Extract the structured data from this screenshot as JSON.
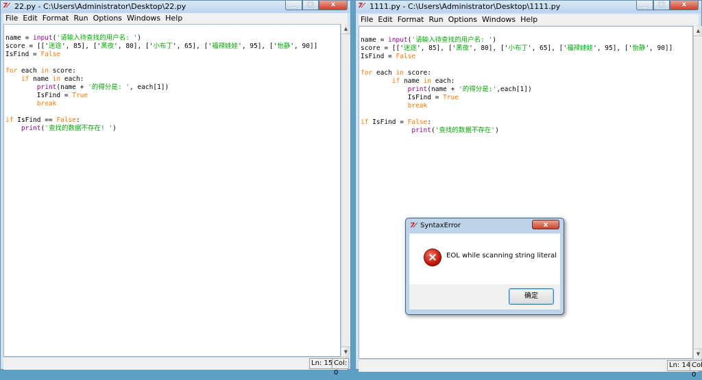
{
  "left_window": {
    "title": "22.py - C:\\Users\\Administrator\\Desktop\\22.py",
    "icon": "tk-feather-icon",
    "menu": [
      "File",
      "Edit",
      "Format",
      "Run",
      "Options",
      "Windows",
      "Help"
    ],
    "status_ln": "Ln: 15",
    "status_col": "Col: 0"
  },
  "right_window": {
    "title": "1111.py - C:\\Users\\Administrator\\Desktop\\1111.py",
    "icon": "tk-feather-icon",
    "menu": [
      "File",
      "Edit",
      "Format",
      "Run",
      "Options",
      "Windows",
      "Help"
    ],
    "status_ln": "Ln: 14",
    "status_col": "Col: 0"
  },
  "left_code": [
    [
      [
        "",
        "name = "
      ],
      [
        "bi",
        "input"
      ],
      [
        "",
        "("
      ],
      [
        "st",
        "'请输入待查找的用户名: '"
      ],
      [
        "",
        ")"
      ]
    ],
    [
      [
        "",
        "score = [['"
      ],
      [
        "st",
        "迷途"
      ],
      [
        "",
        "', 85], ['"
      ],
      [
        "st",
        "黑夜"
      ],
      [
        "",
        "', 80], ['"
      ],
      [
        "st",
        "小布丁"
      ],
      [
        "",
        "', 65], ['"
      ],
      [
        "st",
        "福禄娃娃"
      ],
      [
        "",
        "', 95], ['"
      ],
      [
        "st",
        "怡静"
      ],
      [
        "",
        "', 90]]"
      ]
    ],
    [
      [
        "",
        "IsFind = "
      ],
      [
        "kw",
        "False"
      ]
    ],
    [
      [
        "",
        ""
      ]
    ],
    [
      [
        "kw",
        "for"
      ],
      [
        "",
        " each "
      ],
      [
        "kw",
        "in"
      ],
      [
        "",
        " score:"
      ]
    ],
    [
      [
        "",
        "    "
      ],
      [
        "kw",
        "if"
      ],
      [
        "",
        " name "
      ],
      [
        "kw",
        "in"
      ],
      [
        "",
        " each:"
      ]
    ],
    [
      [
        "",
        "        "
      ],
      [
        "bi",
        "print"
      ],
      [
        "",
        "(name + "
      ],
      [
        "st",
        "'的得分是: '"
      ],
      [
        "",
        ", each[1])"
      ]
    ],
    [
      [
        "",
        "        IsFind = "
      ],
      [
        "kw",
        "True"
      ]
    ],
    [
      [
        "",
        "        "
      ],
      [
        "kw",
        "break"
      ]
    ],
    [
      [
        "",
        ""
      ]
    ],
    [
      [
        "kw",
        "if"
      ],
      [
        "",
        " IsFind == "
      ],
      [
        "kw",
        "False"
      ],
      [
        "",
        ":"
      ]
    ],
    [
      [
        "",
        "    "
      ],
      [
        "bi",
        "print"
      ],
      [
        "",
        "("
      ],
      [
        "st",
        "'查找的数据不存在! '"
      ],
      [
        "",
        ")"
      ]
    ]
  ],
  "right_code": [
    [
      [
        "",
        "name = "
      ],
      [
        "bi",
        "input"
      ],
      [
        "",
        "("
      ],
      [
        "st",
        "'请输入待查找的用户名: '"
      ],
      [
        "",
        ")"
      ]
    ],
    [
      [
        "",
        "score = [['"
      ],
      [
        "st",
        "迷途"
      ],
      [
        "",
        "', 85], ['"
      ],
      [
        "st",
        "黑夜"
      ],
      [
        "",
        "', 80], ['"
      ],
      [
        "st",
        "小布丁"
      ],
      [
        "",
        "', 65], ['"
      ],
      [
        "st",
        "福禄娃娃"
      ],
      [
        "",
        "', 95], ['"
      ],
      [
        "st",
        "怡静"
      ],
      [
        "",
        "', 90]]"
      ]
    ],
    [
      [
        "",
        "IsFind = "
      ],
      [
        "kw",
        "False"
      ]
    ],
    [
      [
        "",
        ""
      ]
    ],
    [
      [
        "kw",
        "for"
      ],
      [
        "",
        " each "
      ],
      [
        "kw",
        "in"
      ],
      [
        "",
        " score:"
      ]
    ],
    [
      [
        "",
        "        "
      ],
      [
        "kw",
        "if"
      ],
      [
        "",
        " name "
      ],
      [
        "kw",
        "in"
      ],
      [
        "",
        " each:"
      ]
    ],
    [
      [
        "",
        "            "
      ],
      [
        "bi",
        "print"
      ],
      [
        "",
        "(name + "
      ],
      [
        "st",
        "'的得分是:'"
      ],
      [
        "",
        ",each[1])"
      ]
    ],
    [
      [
        "",
        "            IsFind = "
      ],
      [
        "kw",
        "True"
      ]
    ],
    [
      [
        "",
        "            "
      ],
      [
        "kw",
        "break"
      ]
    ],
    [
      [
        "",
        ""
      ]
    ],
    [
      [
        "kw",
        "if"
      ],
      [
        "",
        " IsFind = "
      ],
      [
        "kw",
        "False"
      ],
      [
        "",
        ":"
      ]
    ],
    [
      [
        "",
        "             "
      ],
      [
        "bi",
        "print"
      ],
      [
        "",
        "("
      ],
      [
        "st",
        "'查找的数据不存在'"
      ],
      [
        "",
        ")"
      ]
    ]
  ],
  "dialog": {
    "title": "SyntaxError",
    "icon": "error-icon",
    "message": "EOL while scanning string literal",
    "ok_label": "确定",
    "close_label": "x"
  },
  "window_controls": {
    "minimize": "▁",
    "maximize": "□",
    "close": "x"
  },
  "colors": {
    "keyword": "#ff7700",
    "builtin": "#900090",
    "string": "#00aa00"
  }
}
